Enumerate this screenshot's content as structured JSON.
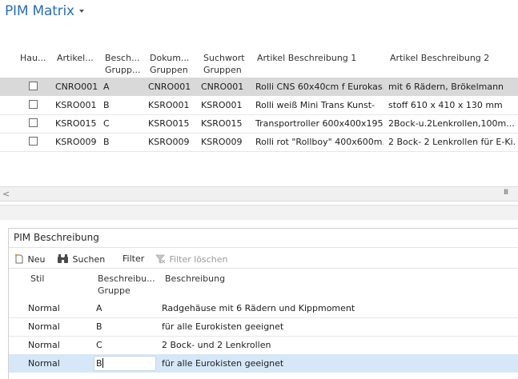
{
  "page": {
    "title": "PIM Matrix"
  },
  "grid": {
    "headers": [
      {
        "line1": "Hau...",
        "line2": ""
      },
      {
        "line1": "Artikel...",
        "line2": ""
      },
      {
        "line1": "Besch...",
        "line2": "Grupp..."
      },
      {
        "line1": "Dokum...",
        "line2": "Gruppen"
      },
      {
        "line1": "Suchwort",
        "line2": "Gruppen"
      },
      {
        "line1": "Artikel Beschreibung 1",
        "line2": ""
      },
      {
        "line1": "Artikel Beschreibung 2",
        "line2": ""
      }
    ],
    "rows": [
      {
        "checked": false,
        "artikel": "CNRO001",
        "besch": "A",
        "dokum": "CNRO001",
        "suchwort": "CNRO001",
        "beschr1": "Rolli CNS 60x40cm f Eurokas...",
        "beschr2": "mit 6 Rädern, Brökelmann"
      },
      {
        "checked": false,
        "artikel": "KSRO001",
        "besch": "B",
        "dokum": "KSRO001",
        "suchwort": "KSRO001",
        "beschr1": "Rolli weiß Mini Trans Kunst-",
        "beschr2": "stoff 610 x 410 x 130 mm"
      },
      {
        "checked": false,
        "artikel": "KSRO015",
        "besch": "C",
        "dokum": "KSRO015",
        "suchwort": "KSRO015",
        "beschr1": "Transportroller  600x400x195...",
        "beschr2": "2Bock-u.2Lenkrollen,100m..."
      },
      {
        "checked": false,
        "artikel": "KSRO009",
        "besch": "B",
        "dokum": "KSRO009",
        "suchwort": "KSRO009",
        "beschr1": "Rolli rot \"Rollboy\" 400x600m...",
        "beschr2": "2 Bock- 2 Lenkrollen für E-Ki..."
      }
    ],
    "scroll_left_icon": "<",
    "scroll_grip_icon": "III"
  },
  "panel": {
    "title": "PIM Beschreibung",
    "toolbar": {
      "new_label": "Neu",
      "search_label": "Suchen",
      "filter_label": "Filter",
      "clear_filter_label": "Filter löschen"
    },
    "headers": {
      "stil": "Stil",
      "gruppe_line1": "Beschreibu...",
      "gruppe_line2": "Gruppe",
      "beschreibung": "Beschreibung"
    },
    "rows": [
      {
        "stil": "Normal",
        "gruppe": "A",
        "beschreibung": "Radgehäuse mit 6 Rädern und Kippmoment"
      },
      {
        "stil": "Normal",
        "gruppe": "B",
        "beschreibung": "für alle Eurokisten geeignet"
      },
      {
        "stil": "Normal",
        "gruppe": "C",
        "beschreibung": "2 Bock- und 2 Lenkrollen"
      },
      {
        "stil": "Normal",
        "gruppe": "B",
        "beschreibung": "für alle Eurokisten geeignet"
      }
    ]
  }
}
